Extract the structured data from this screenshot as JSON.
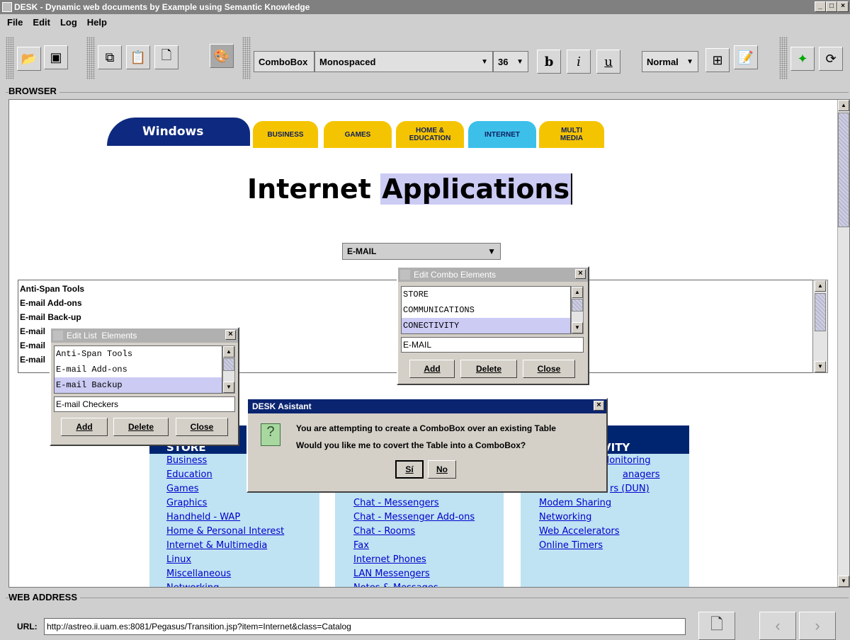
{
  "window": {
    "title": "DESK - Dynamic web documents by Example using Semantic Knowledge"
  },
  "menu": [
    "File",
    "Edit",
    "Log",
    "Help"
  ],
  "toolbar": {
    "element_type": "ComboBox",
    "font": "Monospaced",
    "size": "36",
    "bold": "b",
    "italic": "i",
    "underline": "u",
    "style": "Normal"
  },
  "browser_label": "BROWSER",
  "page": {
    "logo": "Windows",
    "tabs": [
      "BUSINESS",
      "GAMES",
      "HOME & EDUCATION",
      "INTERNET",
      "MULTI MEDIA"
    ],
    "heading_part1": "Internet",
    "heading_part2": "Applications",
    "combo_value": "E-MAIL",
    "list_items": [
      "Anti-Span Tools",
      "E-mail Add-ons",
      "E-mail Back-up",
      "E-mail",
      "E-mail",
      "E-mail"
    ],
    "columns": [
      {
        "header": "STORE",
        "links": [
          "Business",
          "Education",
          "Games",
          "Graphics",
          "Handheld - WAP",
          "Home & Personal Interest",
          "Internet & Multimedia",
          "Linux",
          "Miscellaneous",
          "Networking"
        ]
      },
      {
        "header": "",
        "links": [
          "Chat - Messengers",
          "Chat - Messenger Add-ons",
          "Chat - Rooms",
          "Fax",
          "Internet Phones",
          "LAN Messengers",
          "Notes & Messages"
        ]
      },
      {
        "header": "VITY",
        "links": [
          "Monitoring",
          "anagers",
          "rs (DUN)",
          "Modem Sharing",
          "Networking",
          "Web Accelerators",
          "Online Timers"
        ]
      }
    ]
  },
  "combo_dialog": {
    "title": "Edit Combo Elements",
    "items": [
      "STORE",
      "COMMUNICATIONS",
      "CONECTIVITY"
    ],
    "selected": "CONECTIVITY",
    "input": "E-MAIL",
    "add": "Add",
    "delete": "Delete",
    "close": "Close"
  },
  "list_dialog": {
    "title": "Edit List  Elements",
    "items": [
      "Anti-Span Tools",
      "E-mail Add-ons",
      "E-mail Backup"
    ],
    "selected": "E-mail Backup",
    "input": "E-mail Checkers",
    "add": "Add",
    "delete": "Delete",
    "close": "Close"
  },
  "assistant": {
    "title": "DESK Asistant",
    "line1": "You are attempting to create a ComboBox over an existing Table",
    "line2": "Would you like me to covert the Table into a ComboBox?",
    "yes": "Sí",
    "no": "No"
  },
  "address": {
    "label": "WEB ADDRESS",
    "url_label": "URL:",
    "url": "http://astreo.ii.uam.es:8081/Pegasus/Transition.jsp?item=Internet&class=Catalog"
  }
}
